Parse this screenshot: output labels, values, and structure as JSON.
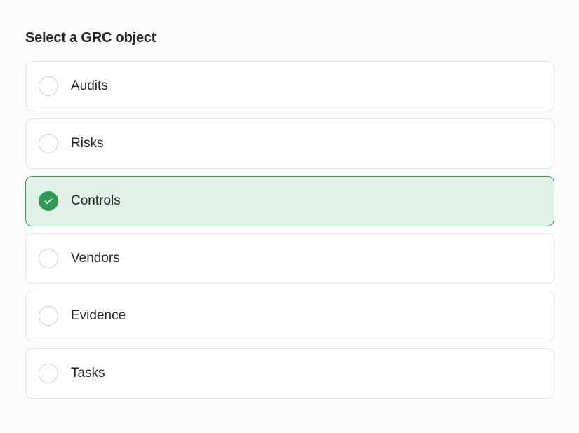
{
  "heading": "Select a GRC object",
  "options": [
    {
      "label": "Audits",
      "selected": false
    },
    {
      "label": "Risks",
      "selected": false
    },
    {
      "label": "Controls",
      "selected": true
    },
    {
      "label": "Vendors",
      "selected": false
    },
    {
      "label": "Evidence",
      "selected": false
    },
    {
      "label": "Tasks",
      "selected": false
    }
  ],
  "colors": {
    "accent": "#2e9a55",
    "selected_background": "#e1f1e6",
    "border": "#e4e4e4"
  }
}
